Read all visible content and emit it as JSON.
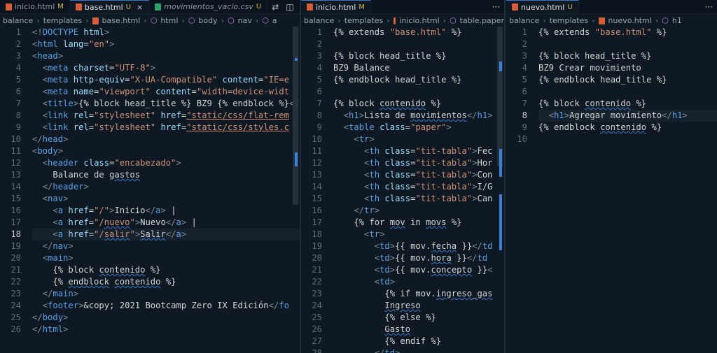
{
  "pane1": {
    "tabs": [
      {
        "label": "inicio.html",
        "status": "M",
        "italic": false
      },
      {
        "label": "base.html",
        "status": "U",
        "italic": false,
        "active": true
      },
      {
        "label": "movimientos_vacio.csv",
        "status": "U",
        "italic": true
      }
    ],
    "breadcrumbs": [
      "balance",
      "templates",
      "base.html",
      "html",
      "body",
      "nav",
      "a"
    ],
    "current_line": 18,
    "lines": [
      {
        "n": "1",
        "h": "<span class='pu'>&lt;!</span><span class='t'>DOCTYPE</span> <span class='a'>html</span><span class='pu'>&gt;</span>"
      },
      {
        "n": "2",
        "h": "<span class='pu'>&lt;</span><span class='t'>html</span> <span class='a'>lang</span>=<span class='s'>\"en\"</span><span class='pu'>&gt;</span>"
      },
      {
        "n": "3",
        "h": "<span class='pu'>&lt;</span><span class='t'>head</span><span class='pu'>&gt;</span>"
      },
      {
        "n": "4",
        "h": "  <span class='pu'>&lt;</span><span class='t'>meta</span> <span class='a'>charset</span>=<span class='s'>\"UTF-8\"</span><span class='pu'>&gt;</span>"
      },
      {
        "n": "5",
        "h": "  <span class='pu'>&lt;</span><span class='t'>meta</span> <span class='a'>http-equiv</span>=<span class='s'>\"X-UA-Compatible\"</span> <span class='a'>content</span>=<span class='s'>\"IE=e</span>"
      },
      {
        "n": "6",
        "h": "  <span class='pu'>&lt;</span><span class='t'>meta</span> <span class='a'>name</span>=<span class='s'>\"viewport\"</span> <span class='a'>content</span>=<span class='s'>\"width=device-widt</span>"
      },
      {
        "n": "7",
        "h": "  <span class='pu'>&lt;</span><span class='t'>title</span><span class='pu'>&gt;</span><span class='j'>{% block head_title %}</span> BZ9 <span class='j'>{% endblock %}</span><span class='pu'>&lt;/</span>"
      },
      {
        "n": "8",
        "h": "  <span class='pu'>&lt;</span><span class='t'>link</span> <span class='a'>rel</span>=<span class='s'>\"stylesheet\"</span> <span class='a'>href</span>=<span class='s ul'>\"static/css/flat-rem</span>"
      },
      {
        "n": "9",
        "h": "  <span class='pu'>&lt;</span><span class='t'>link</span> <span class='a'>rel</span>=<span class='s'>\"stylesheet\"</span> <span class='a'>href</span>=<span class='s ul'>\"static/css/styles.c</span>"
      },
      {
        "n": "10",
        "h": "<span class='pu'>&lt;/</span><span class='t'>head</span><span class='pu'>&gt;</span>"
      },
      {
        "n": "11",
        "h": "<span class='pu'>&lt;</span><span class='t'>body</span><span class='pu'>&gt;</span>"
      },
      {
        "n": "12",
        "h": "  <span class='pu'>&lt;</span><span class='t'>header</span> <span class='a'>class</span>=<span class='s'>\"encabezado\"</span><span class='pu'>&gt;</span>"
      },
      {
        "n": "13",
        "h": "    <span class='tx'>Balance de <span class='sq'>gastos</span></span>"
      },
      {
        "n": "14",
        "h": "  <span class='pu'>&lt;/</span><span class='t'>header</span><span class='pu'>&gt;</span>"
      },
      {
        "n": "15",
        "h": "  <span class='pu'>&lt;</span><span class='t'>nav</span><span class='pu'>&gt;</span>"
      },
      {
        "n": "16",
        "h": "    <span class='pu'>&lt;</span><span class='t'>a</span> <span class='a'>href</span>=<span class='s'>\"/\"</span><span class='pu'>&gt;</span>Inicio<span class='pu'>&lt;/</span><span class='t'>a</span><span class='pu'>&gt;</span> |"
      },
      {
        "n": "17",
        "h": "    <span class='pu'>&lt;</span><span class='t'>a</span> <span class='a'>href</span>=<span class='s'>\"/<span class='sq'>nuevo</span>\"</span><span class='pu'>&gt;</span>Nuevo<span class='pu'>&lt;/</span><span class='t'>a</span><span class='pu'>&gt;</span> |"
      },
      {
        "n": "18",
        "h": "    <span class='pu'>&lt;</span><span class='t'>a</span> <span class='a'>href</span>=<span class='s'>\"/<span class='sq'>salir</span>\"</span><span class='pu'>&gt;</span><span class='sq'>Salir</span><span class='pu'>&lt;/</span><span class='t'>a</span><span class='pu'>&gt;</span>"
      },
      {
        "n": "19",
        "h": "  <span class='pu'>&lt;/</span><span class='t'>nav</span><span class='pu'>&gt;</span>"
      },
      {
        "n": "20",
        "h": "  <span class='pu'>&lt;</span><span class='t'>main</span><span class='pu'>&gt;</span>"
      },
      {
        "n": "21",
        "h": "    <span class='j'>{% block <span class='sq'>contenido</span> %}</span>"
      },
      {
        "n": "22",
        "h": "    <span class='j'>{% <span class='sq'>endblock</span> <span class='sq'>contenido</span> %}</span>"
      },
      {
        "n": "23",
        "h": "  <span class='pu'>&lt;/</span><span class='t'>main</span><span class='pu'>&gt;</span>"
      },
      {
        "n": "24",
        "h": "  <span class='pu'>&lt;</span><span class='t'>footer</span><span class='pu'>&gt;</span>&amp;copy; 2021 Bootcamp Zero IX Edición<span class='pu'>&lt;/</span><span class='t'>fo</span>"
      },
      {
        "n": "25",
        "h": "<span class='pu'>&lt;/</span><span class='t'>body</span><span class='pu'>&gt;</span>"
      },
      {
        "n": "26",
        "h": "<span class='pu'>&lt;/</span><span class='t'>html</span><span class='pu'>&gt;</span>"
      }
    ]
  },
  "pane2": {
    "tabs": [
      {
        "label": "inicio.html",
        "status": "M",
        "italic": false,
        "active": true
      }
    ],
    "breadcrumbs": [
      "balance",
      "templates",
      "inicio.html",
      "table.paper"
    ],
    "lines": [
      {
        "n": "1",
        "h": "<span class='j'>{% extends <span class='s'>\"base.html\"</span> %}</span>"
      },
      {
        "n": "2",
        "h": ""
      },
      {
        "n": "3",
        "h": "<span class='j'>{% block head_title %}</span>"
      },
      {
        "n": "4",
        "h": "BZ9 Balance"
      },
      {
        "n": "5",
        "h": "<span class='j'>{% endblock head_title %}</span>"
      },
      {
        "n": "6",
        "h": ""
      },
      {
        "n": "7",
        "h": "<span class='j'>{% block <span class='sq'>contenido</span> %}</span>"
      },
      {
        "n": "8",
        "h": "  <span class='pu'>&lt;</span><span class='t'>h1</span><span class='pu'>&gt;</span>Lista de <span class='sq'>movimientos</span><span class='pu'>&lt;/</span><span class='t'>h1</span><span class='pu'>&gt;</span>"
      },
      {
        "n": "9",
        "h": "  <span class='pu'>&lt;</span><span class='t'>table</span> <span class='a'>class</span>=<span class='s'>\"paper\"</span><span class='pu'>&gt;</span>"
      },
      {
        "n": "10",
        "h": "    <span class='pu'>&lt;</span><span class='t'>tr</span><span class='pu'>&gt;</span>"
      },
      {
        "n": "11",
        "h": "      <span class='pu'>&lt;</span><span class='t'>th</span> <span class='a'>class</span>=<span class='s'>\"tit-tabla\"</span><span class='pu'>&gt;</span>Fec"
      },
      {
        "n": "12",
        "h": "      <span class='pu'>&lt;</span><span class='t'>th</span> <span class='a'>class</span>=<span class='s'>\"tit-tabla\"</span><span class='pu'>&gt;</span>Hor"
      },
      {
        "n": "13",
        "h": "      <span class='pu'>&lt;</span><span class='t'>th</span> <span class='a'>class</span>=<span class='s'>\"tit-tabla\"</span><span class='pu'>&gt;</span>Con"
      },
      {
        "n": "14",
        "h": "      <span class='pu'>&lt;</span><span class='t'>th</span> <span class='a'>class</span>=<span class='s'>\"tit-tabla\"</span><span class='pu'>&gt;</span>I/G"
      },
      {
        "n": "15",
        "h": "      <span class='pu'>&lt;</span><span class='t'>th</span> <span class='a'>class</span>=<span class='s'>\"tit-tabla\"</span><span class='pu'>&gt;</span>Can"
      },
      {
        "n": "16",
        "h": "    <span class='pu'>&lt;/</span><span class='t'>tr</span><span class='pu'>&gt;</span>"
      },
      {
        "n": "17",
        "h": "    <span class='j'>{% for <span class='sq'>mov</span> in <span class='sq'>movs</span> %}</span>"
      },
      {
        "n": "18",
        "h": "      <span class='pu'>&lt;</span><span class='t'>tr</span><span class='pu'>&gt;</span>"
      },
      {
        "n": "19",
        "h": "        <span class='pu'>&lt;</span><span class='t'>td</span><span class='pu'>&gt;</span>{{ mov.<span class='sq'>fecha</span> }}<span class='pu'>&lt;/</span><span class='t'>td</span>"
      },
      {
        "n": "20",
        "h": "        <span class='pu'>&lt;</span><span class='t'>td</span><span class='pu'>&gt;</span>{{ mov.<span class='sq'>hora</span> }}<span class='pu'>&lt;/</span><span class='t'>td</span>"
      },
      {
        "n": "21",
        "h": "        <span class='pu'>&lt;</span><span class='t'>td</span><span class='pu'>&gt;</span>{{ mov.<span class='sq'>concepto</span> }}<span class='pu'>&lt;</span>"
      },
      {
        "n": "22",
        "h": "        <span class='pu'>&lt;</span><span class='t'>td</span><span class='pu'>&gt;</span>"
      },
      {
        "n": "23",
        "h": "          <span class='j'>{% if mov.<span class='sq'>ingreso_gas</span></span>"
      },
      {
        "n": "24",
        "h": "          <span class='sq'>Ingreso</span>"
      },
      {
        "n": "25",
        "h": "          <span class='j'>{% else %}</span>"
      },
      {
        "n": "26",
        "h": "          <span class='sq'>Gasto</span>"
      },
      {
        "n": "27",
        "h": "          <span class='j'>{% endif %}</span>"
      },
      {
        "n": "28",
        "h": "        <span class='pu'>&lt;/</span><span class='t'>td</span><span class='pu'>&gt;</span>"
      }
    ]
  },
  "pane3": {
    "tabs": [
      {
        "label": "nuevo.html",
        "status": "U",
        "italic": false,
        "active": true
      }
    ],
    "breadcrumbs": [
      "balance",
      "templates",
      "nuevo.html",
      "h1"
    ],
    "current_line": 8,
    "lines": [
      {
        "n": "1",
        "h": "<span class='j'>{% extends <span class='s'>\"base.html\"</span> %}</span>"
      },
      {
        "n": "2",
        "h": ""
      },
      {
        "n": "3",
        "h": "<span class='j'>{% block head_title %}</span>"
      },
      {
        "n": "4",
        "h": "BZ9 Crear movimiento"
      },
      {
        "n": "5",
        "h": "<span class='j'>{% endblock head_title %}</span>"
      },
      {
        "n": "6",
        "h": ""
      },
      {
        "n": "7",
        "h": "<span class='j'>{% block <span class='sq'>contenido</span> %}</span>"
      },
      {
        "n": "8",
        "h": "  <span class='pu'>&lt;</span><span class='t'>h1</span><span class='pu'>&gt;</span>Agregar movimiento<span class='pu'>&lt;/</span><span class='t'>h1</span><span class='pu'>&gt;</span>"
      },
      {
        "n": "9",
        "h": "<span class='j'>{% endblock <span class='sq'>contenido</span> %}</span>"
      },
      {
        "n": "10",
        "h": ""
      }
    ]
  }
}
